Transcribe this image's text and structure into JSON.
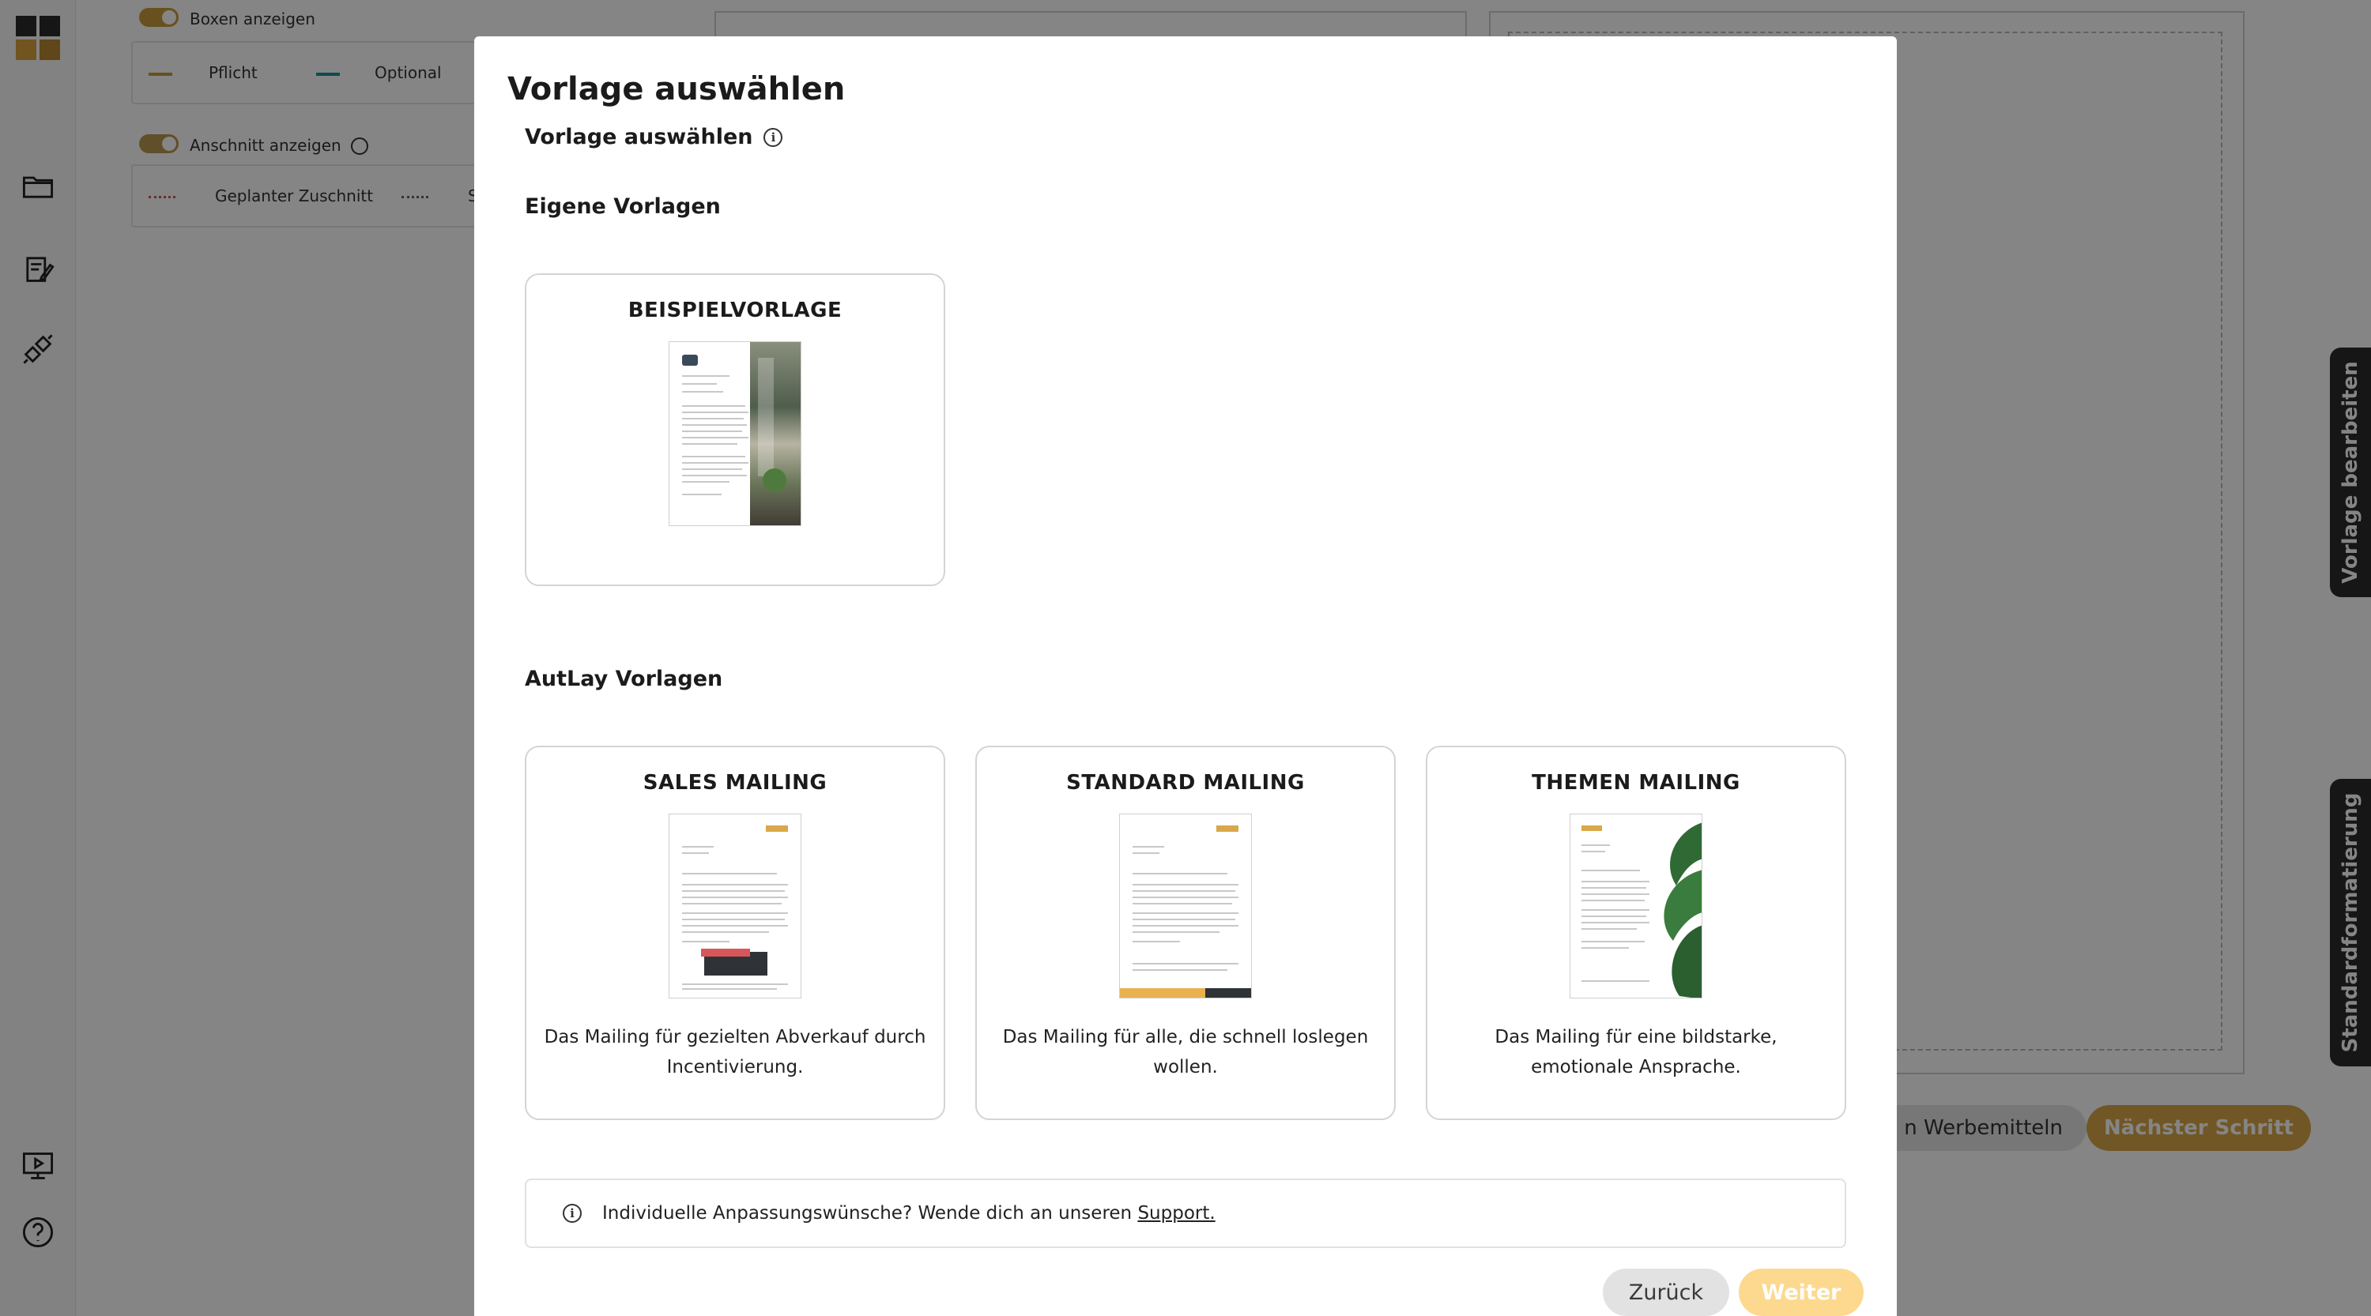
{
  "background": {
    "toggle_boxes_label": "Boxen anzeigen",
    "legend_required": "Pflicht",
    "legend_optional": "Optional",
    "toggle_bleed_label": "Anschnitt anzeigen",
    "legend_planned_cut": "Geplanter Zuschnitt",
    "legend_cut_truncated": "S",
    "side_tab_edit": "Vorlage bearbeiten",
    "side_tab_format": "Standardformatierung",
    "submit_button_partial": "n Werbemitteln",
    "next_step_button": "Nächster Schritt"
  },
  "modal": {
    "title": "Vorlage auswählen",
    "subtitle": "Vorlage auswählen",
    "own_section_title": "Eigene Vorlagen",
    "autlay_section_title": "AutLay Vorlagen",
    "own_templates": [
      {
        "title": "BEISPIELVORLAGE"
      }
    ],
    "autlay_templates": [
      {
        "title": "SALES MAILING",
        "description": "Das Mailing für gezielten Abverkauf durch Incentivierung."
      },
      {
        "title": "STANDARD MAILING",
        "description": "Das Mailing für alle, die schnell loslegen wollen."
      },
      {
        "title": "THEMEN MAILING",
        "description": "Das Mailing für eine bildstarke, emotionale Ansprache."
      }
    ],
    "info_text": "Individuelle Anpassungswünsche? Wende dich an unseren",
    "info_link": "Support.",
    "back_button": "Zurück",
    "next_button": "Weiter"
  },
  "colors": {
    "accent": "#c89a3c",
    "optional": "#1e8fa0",
    "button_disabled": "#fcd98f"
  },
  "icons": [
    "folder-icon",
    "edit-document-icon",
    "integration-icon",
    "presentation-icon",
    "help-icon",
    "info-icon"
  ]
}
